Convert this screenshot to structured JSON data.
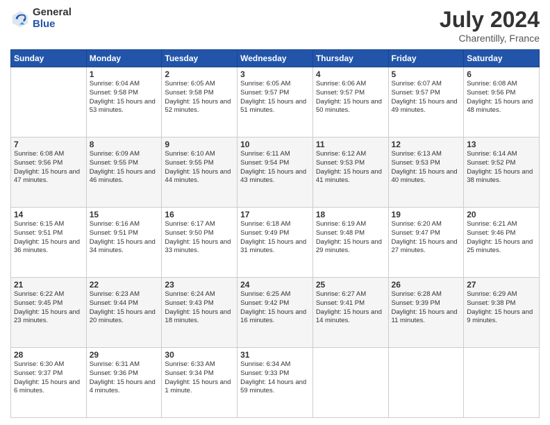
{
  "header": {
    "logo": {
      "general": "General",
      "blue": "Blue"
    },
    "title": "July 2024",
    "subtitle": "Charentilly, France"
  },
  "calendar": {
    "days_of_week": [
      "Sunday",
      "Monday",
      "Tuesday",
      "Wednesday",
      "Thursday",
      "Friday",
      "Saturday"
    ],
    "weeks": [
      [
        {
          "day": "",
          "sunrise": "",
          "sunset": "",
          "daylight": ""
        },
        {
          "day": "1",
          "sunrise": "Sunrise: 6:04 AM",
          "sunset": "Sunset: 9:58 PM",
          "daylight": "Daylight: 15 hours and 53 minutes."
        },
        {
          "day": "2",
          "sunrise": "Sunrise: 6:05 AM",
          "sunset": "Sunset: 9:58 PM",
          "daylight": "Daylight: 15 hours and 52 minutes."
        },
        {
          "day": "3",
          "sunrise": "Sunrise: 6:05 AM",
          "sunset": "Sunset: 9:57 PM",
          "daylight": "Daylight: 15 hours and 51 minutes."
        },
        {
          "day": "4",
          "sunrise": "Sunrise: 6:06 AM",
          "sunset": "Sunset: 9:57 PM",
          "daylight": "Daylight: 15 hours and 50 minutes."
        },
        {
          "day": "5",
          "sunrise": "Sunrise: 6:07 AM",
          "sunset": "Sunset: 9:57 PM",
          "daylight": "Daylight: 15 hours and 49 minutes."
        },
        {
          "day": "6",
          "sunrise": "Sunrise: 6:08 AM",
          "sunset": "Sunset: 9:56 PM",
          "daylight": "Daylight: 15 hours and 48 minutes."
        }
      ],
      [
        {
          "day": "7",
          "sunrise": "Sunrise: 6:08 AM",
          "sunset": "Sunset: 9:56 PM",
          "daylight": "Daylight: 15 hours and 47 minutes."
        },
        {
          "day": "8",
          "sunrise": "Sunrise: 6:09 AM",
          "sunset": "Sunset: 9:55 PM",
          "daylight": "Daylight: 15 hours and 46 minutes."
        },
        {
          "day": "9",
          "sunrise": "Sunrise: 6:10 AM",
          "sunset": "Sunset: 9:55 PM",
          "daylight": "Daylight: 15 hours and 44 minutes."
        },
        {
          "day": "10",
          "sunrise": "Sunrise: 6:11 AM",
          "sunset": "Sunset: 9:54 PM",
          "daylight": "Daylight: 15 hours and 43 minutes."
        },
        {
          "day": "11",
          "sunrise": "Sunrise: 6:12 AM",
          "sunset": "Sunset: 9:53 PM",
          "daylight": "Daylight: 15 hours and 41 minutes."
        },
        {
          "day": "12",
          "sunrise": "Sunrise: 6:13 AM",
          "sunset": "Sunset: 9:53 PM",
          "daylight": "Daylight: 15 hours and 40 minutes."
        },
        {
          "day": "13",
          "sunrise": "Sunrise: 6:14 AM",
          "sunset": "Sunset: 9:52 PM",
          "daylight": "Daylight: 15 hours and 38 minutes."
        }
      ],
      [
        {
          "day": "14",
          "sunrise": "Sunrise: 6:15 AM",
          "sunset": "Sunset: 9:51 PM",
          "daylight": "Daylight: 15 hours and 36 minutes."
        },
        {
          "day": "15",
          "sunrise": "Sunrise: 6:16 AM",
          "sunset": "Sunset: 9:51 PM",
          "daylight": "Daylight: 15 hours and 34 minutes."
        },
        {
          "day": "16",
          "sunrise": "Sunrise: 6:17 AM",
          "sunset": "Sunset: 9:50 PM",
          "daylight": "Daylight: 15 hours and 33 minutes."
        },
        {
          "day": "17",
          "sunrise": "Sunrise: 6:18 AM",
          "sunset": "Sunset: 9:49 PM",
          "daylight": "Daylight: 15 hours and 31 minutes."
        },
        {
          "day": "18",
          "sunrise": "Sunrise: 6:19 AM",
          "sunset": "Sunset: 9:48 PM",
          "daylight": "Daylight: 15 hours and 29 minutes."
        },
        {
          "day": "19",
          "sunrise": "Sunrise: 6:20 AM",
          "sunset": "Sunset: 9:47 PM",
          "daylight": "Daylight: 15 hours and 27 minutes."
        },
        {
          "day": "20",
          "sunrise": "Sunrise: 6:21 AM",
          "sunset": "Sunset: 9:46 PM",
          "daylight": "Daylight: 15 hours and 25 minutes."
        }
      ],
      [
        {
          "day": "21",
          "sunrise": "Sunrise: 6:22 AM",
          "sunset": "Sunset: 9:45 PM",
          "daylight": "Daylight: 15 hours and 23 minutes."
        },
        {
          "day": "22",
          "sunrise": "Sunrise: 6:23 AM",
          "sunset": "Sunset: 9:44 PM",
          "daylight": "Daylight: 15 hours and 20 minutes."
        },
        {
          "day": "23",
          "sunrise": "Sunrise: 6:24 AM",
          "sunset": "Sunset: 9:43 PM",
          "daylight": "Daylight: 15 hours and 18 minutes."
        },
        {
          "day": "24",
          "sunrise": "Sunrise: 6:25 AM",
          "sunset": "Sunset: 9:42 PM",
          "daylight": "Daylight: 15 hours and 16 minutes."
        },
        {
          "day": "25",
          "sunrise": "Sunrise: 6:27 AM",
          "sunset": "Sunset: 9:41 PM",
          "daylight": "Daylight: 15 hours and 14 minutes."
        },
        {
          "day": "26",
          "sunrise": "Sunrise: 6:28 AM",
          "sunset": "Sunset: 9:39 PM",
          "daylight": "Daylight: 15 hours and 11 minutes."
        },
        {
          "day": "27",
          "sunrise": "Sunrise: 6:29 AM",
          "sunset": "Sunset: 9:38 PM",
          "daylight": "Daylight: 15 hours and 9 minutes."
        }
      ],
      [
        {
          "day": "28",
          "sunrise": "Sunrise: 6:30 AM",
          "sunset": "Sunset: 9:37 PM",
          "daylight": "Daylight: 15 hours and 6 minutes."
        },
        {
          "day": "29",
          "sunrise": "Sunrise: 6:31 AM",
          "sunset": "Sunset: 9:36 PM",
          "daylight": "Daylight: 15 hours and 4 minutes."
        },
        {
          "day": "30",
          "sunrise": "Sunrise: 6:33 AM",
          "sunset": "Sunset: 9:34 PM",
          "daylight": "Daylight: 15 hours and 1 minute."
        },
        {
          "day": "31",
          "sunrise": "Sunrise: 6:34 AM",
          "sunset": "Sunset: 9:33 PM",
          "daylight": "Daylight: 14 hours and 59 minutes."
        },
        {
          "day": "",
          "sunrise": "",
          "sunset": "",
          "daylight": ""
        },
        {
          "day": "",
          "sunrise": "",
          "sunset": "",
          "daylight": ""
        },
        {
          "day": "",
          "sunrise": "",
          "sunset": "",
          "daylight": ""
        }
      ]
    ]
  }
}
